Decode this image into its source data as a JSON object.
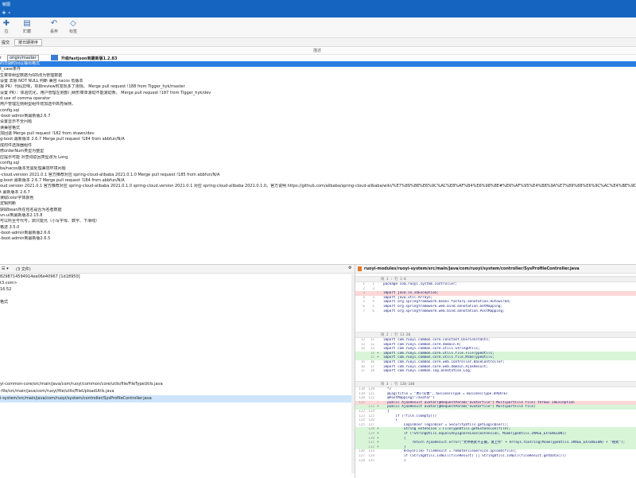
{
  "window": {
    "title": "敏图",
    "menu_glyphs": "+ -"
  },
  "toolbar": {
    "buttons": [
      {
        "icon": "cursor",
        "glyph": "✚",
        "label": "拉"
      },
      {
        "icon": "file-icon",
        "glyph": "▤",
        "label": "贮藏"
      },
      {
        "icon": "undo-icon",
        "glyph": "↶",
        "label": "丢弃"
      },
      {
        "icon": "tag-icon",
        "glyph": "◇",
        "label": "标签"
      }
    ]
  },
  "subbar": {
    "tab1": "提交",
    "tab2": "按日期排序"
  },
  "column_header": "描述",
  "branch": {
    "prefix": "r",
    "origin": "origin/master",
    "tag": "升级fastjson到最新版1.2.83"
  },
  "commits": [
    "的日期时间以输出格式",
    "t_case条件",
    "生菜单树型数据为0的改为管理数据",
    "设置 去除 NOT NULL 判断 兼容 nacos 低版本",
    "报 PR）代码异味，项目review时发现多了违规。 Merge pull request !188 from Tigger_hyk/master",
    "设置 PR）：体验优化，用户管理左侧部门树形菜单滚动不能滚动条。 Merge pull request !187 from Tigger_hyk/dev",
    "d use of comma operator",
    "用户管理左侧树型组件增加选中高亮保持。",
    "config.sql",
    "-boot-admin到最新版2.6.7",
    "设置显示不全问题",
    "读兼容格式",
    "加回退 Merge pull request !182 from shawn/dev",
    "g-boot 最新版本 2.6.7 Merge pull request !184 from abbfun/N/A",
    "成附件选择器组件",
    "修orderNum类型为整型",
    "应提示可能 对查询返回类型改为 Long",
    "config.sql",
    "ba/nacos版本无需处理兼容环境问题",
    "-cloud.version 2021.0.1 官方推荐对应 spring-cloud-alibaba 2021.0.1.0 Merge pull request !185 from abbfun/N/A",
    "g-boot 最新版本 2.6.7 Merge pull request !184 from abbfun/N/A",
    "oud.version 2021.0.1 官方推荐对应 spring-cloud-alibaba 2021.0.1.0 spring-cloud.version 2021.0.1 对应 spring-cloud-alibaba 2021.0.1.0。官方说明 https://github.com/alibaba/spring-cloud-alibaba/wiki/%E7%89%88%E6%9C%AC%E8%AF%B4%E6%98%8E#%E6%AF%95%E4%B8%9A%E7%89%88%E6%9C%AC%E4%BE%9D",
    "t 最新版本 2.6.7",
    "读取color字体颜色",
    "逻辑判断",
    "获取bean所在包名是否为名者数据",
    "vn-ui到最新版本2.15.8",
    "可以所至号代号，启只能允（小写字母、数字、下滑线）",
    "格述 3.5.0",
    "-boot-admin到最新版2.6.6",
    "-boot-admin到最新版2.6.5"
  ],
  "details": {
    "header_left": "☰ ▾",
    "header_count": "(3 文件)",
    "header_right": "⚙",
    "hash": "8298714594914ea06e40967 [1d18950]",
    "author": "t3.com>",
    "date": "16:52",
    "empty": "",
    "note": "格式"
  },
  "files": [
    "yi-common-core/src/main/java/com/ruoyi/common/core/utils/file/FileTypeUtils.java",
    "-file/src/main/java/com/ruoyi/file/utils/FileUploadUtils.java",
    "i-system/src/main/java/com/ruoyi/system/controller/SysProfileController.java"
  ],
  "diff": {
    "file": "ruoyi-modules/ruoyi-system/src/main/java/com/ruoyi/system/controller/SysProfileController.java",
    "hunks": [
      {
        "header": "块 1 : 行 1-6",
        "lines": [
          {
            "a": "1",
            "b": "1",
            "s": "",
            "t": "package com.ruoyi.system.controller;",
            "k": ""
          },
          {
            "a": "2",
            "b": "2",
            "s": "",
            "t": "",
            "k": ""
          },
          {
            "a": "3",
            "b": "",
            "s": "-",
            "t": "import java.io.IOException;",
            "k": "del"
          },
          {
            "a": "4",
            "b": "3",
            "s": "",
            "t": "import java.util.Arrays;",
            "k": ""
          },
          {
            "a": "5",
            "b": "4",
            "s": "",
            "t": "import org.springframework.beans.factory.annotation.Autowired;",
            "k": ""
          },
          {
            "a": "6",
            "b": "5",
            "s": "",
            "t": "import org.springframework.web.bind.annotation.GetMapping;",
            "k": ""
          },
          {
            "a": "7",
            "b": "6",
            "s": "",
            "t": "import org.springframework.web.bind.annotation.PostMapping;",
            "k": ""
          }
        ]
      },
      {
        "header": "块 2 : 行 11-20",
        "lines": [
          {
            "a": "12",
            "b": "11",
            "s": "",
            "t": "import com.ruoyi.common.core.constant.UserConstants;",
            "k": ""
          },
          {
            "a": "13",
            "b": "12",
            "s": "",
            "t": "import com.ruoyi.common.core.domain.R;",
            "k": ""
          },
          {
            "a": "14",
            "b": "13",
            "s": "",
            "t": "import com.ruoyi.common.core.utils.StringUtils;",
            "k": ""
          },
          {
            "a": "",
            "b": "14",
            "s": "+",
            "t": "import com.ruoyi.common.core.utils.file.FileTypeUtils;",
            "k": "add"
          },
          {
            "a": "",
            "b": "15",
            "s": "+",
            "t": "import com.ruoyi.common.core.utils.file.MimeTypeUtils;",
            "k": "add"
          },
          {
            "a": "15",
            "b": "16",
            "s": "",
            "t": "import com.ruoyi.common.core.web.controller.BaseController;",
            "k": ""
          },
          {
            "a": "16",
            "b": "17",
            "s": "",
            "t": "import com.ruoyi.common.core.web.domain.AjaxResult;",
            "k": ""
          },
          {
            "a": "17",
            "b": "18",
            "s": "",
            "t": "import com.ruoyi.common.log.annotation.Log;",
            "k": ""
          }
        ]
      },
      {
        "header": "块 3 : 行 120-140",
        "lines": [
          {
            "a": "118",
            "b": "120",
            "s": "",
            "t": "  */",
            "k": ""
          },
          {
            "a": "119",
            "b": "121",
            "s": "",
            "t": "  @Log(title = \"用户头像\", businessType = BusinessType.UPDATE)",
            "k": ""
          },
          {
            "a": "120",
            "b": "122",
            "s": "",
            "t": "  @PostMapping(\"/avatar\")",
            "k": ""
          },
          {
            "a": "121",
            "b": "",
            "s": "-",
            "t": "  public AjaxResult avatar(@RequestParam(\"avatarfile\") MultipartFile file) throws IOException",
            "k": "del"
          },
          {
            "a": "",
            "b": "123",
            "s": "+",
            "t": "  public AjaxResult avatar(@RequestParam(\"avatarfile\") MultipartFile file)",
            "k": "add"
          },
          {
            "a": "122",
            "b": "124",
            "s": "",
            "t": "  {",
            "k": ""
          },
          {
            "a": "123",
            "b": "125",
            "s": "",
            "t": "      if (!file.isEmpty())",
            "k": ""
          },
          {
            "a": "124",
            "b": "126",
            "s": "",
            "t": "      {",
            "k": ""
          },
          {
            "a": "125",
            "b": "127",
            "s": "",
            "t": "          LoginUser loginUser = SecurityUtils.getLoginUser();",
            "k": ""
          },
          {
            "a": "",
            "b": "128",
            "s": "+",
            "t": "          String extension = FileTypeUtils.getExtension(file);",
            "k": "add"
          },
          {
            "a": "",
            "b": "129",
            "s": "+",
            "t": "          if (!StringUtils.equalsAnyIgnoreCase(extension, MimeTypeUtils.IMAGE_EXTENSION))",
            "k": "add"
          },
          {
            "a": "",
            "b": "130",
            "s": "+",
            "t": "          {",
            "k": "add"
          },
          {
            "a": "",
            "b": "131",
            "s": "+",
            "t": "              return AjaxResult.error(\"文件格式不正确，请上传\" + Arrays.toString(MimeTypeUtils.IMAGE_EXTENSION) + \"格式\");",
            "k": "add"
          },
          {
            "a": "",
            "b": "132",
            "s": "+",
            "t": "          }",
            "k": "add"
          },
          {
            "a": "126",
            "b": "133",
            "s": "",
            "t": "          R<SysFile> fileResult = remoteFileService.upload(file);",
            "k": ""
          },
          {
            "a": "127",
            "b": "134",
            "s": "",
            "t": "          if (StringUtils.isNull(fileResult) || StringUtils.isNull(fileResult.getData()))",
            "k": ""
          },
          {
            "a": "128",
            "b": "135",
            "s": "",
            "t": "          {",
            "k": ""
          }
        ]
      }
    ]
  }
}
